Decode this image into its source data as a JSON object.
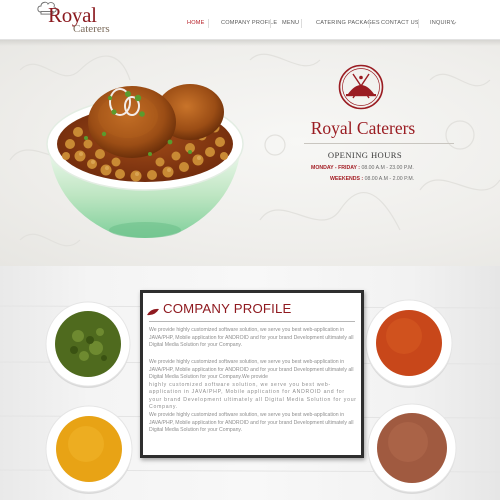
{
  "logo": {
    "name_large": "Royal",
    "name_small": "Caterers",
    "icon": "chef-hat-icon"
  },
  "nav": {
    "items": [
      {
        "label": "HOME",
        "active": true
      },
      {
        "label": "COMPANY PROFILE",
        "active": false
      },
      {
        "label": "MENU",
        "active": false
      },
      {
        "label": "CATERING PACKAGES",
        "active": false
      },
      {
        "label": "CONTACT US",
        "active": false
      },
      {
        "label": "INQUIRY",
        "active": false
      }
    ]
  },
  "hero": {
    "image": "chole-tikki-bowl",
    "emblem_icon": "catering-cloche-icon",
    "brand_title": "Royal Caterers",
    "opening_title": "OPENING HOURS",
    "hours": [
      {
        "days": "MONDAY - FRIDAY :",
        "time": " 08.00 A.M - 23.00 P.M."
      },
      {
        "days": "WEEKENDS :",
        "time": " 08.00 A.M - 2.00 P.M."
      }
    ]
  },
  "company_profile": {
    "title": "COMPANY PROFILE",
    "paragraphs": [
      "We provide highly customized software solution, we serve you best web-application in JAVA/PHP, Mobile application for ANDROID and for your brand Development ultimately all Digital Media Solution for your Company.",
      "We provide highly customized software solution, we serve you best web-application in JAVA/PHP, Mobile application for ANDROID and for your brand Development ultimately all Digital Media Solution for your Company.We provide",
      "highly customized software solution, we serve you best web-application in JAVA/PHP, Mobile application for ANDROID and for your brand Development ultimately all Digital Media Solution for your Company.",
      "We provide highly customized software solution, we serve you best web-application in JAVA/PHP, Mobile application for ANDROID and for your brand Development ultimately all Digital Media Solution for your Company."
    ]
  },
  "spices": [
    {
      "name": "dried-herbs-bowl",
      "color": "#4f6a1e"
    },
    {
      "name": "red-chilli-powder-bowl",
      "color": "#c8471a"
    },
    {
      "name": "turmeric-powder-bowl",
      "color": "#e8a315"
    },
    {
      "name": "garam-masala-bowl",
      "color": "#a05a40"
    }
  ],
  "colors": {
    "brand_red": "#9a1c22",
    "nav_active": "#b51c24",
    "text_gray": "#8e8e8e"
  }
}
